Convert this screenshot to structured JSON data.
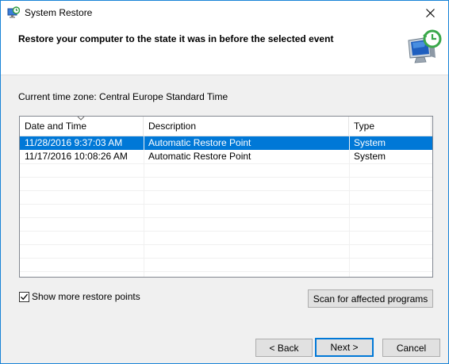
{
  "window": {
    "title": "System Restore",
    "accent_color": "#1883d7"
  },
  "header": {
    "title": "Restore your computer to the state it was in before the selected event"
  },
  "timezone": {
    "label": "Current time zone: Central Europe Standard Time"
  },
  "table": {
    "columns": [
      "Date and Time",
      "Description",
      "Type"
    ],
    "sorted_column": "Date and Time",
    "rows": [
      {
        "date": "11/28/2016 9:37:03 AM",
        "description": "Automatic Restore Point",
        "type": "System",
        "selected": true
      },
      {
        "date": "11/17/2016 10:08:26 AM",
        "description": "Automatic Restore Point",
        "type": "System",
        "selected": false
      }
    ],
    "selection_color": "#0078d7"
  },
  "options": {
    "show_more_label": "Show more restore points",
    "show_more_checked": true
  },
  "buttons": {
    "scan": "Scan for affected programs",
    "back": "< Back",
    "next": "Next >",
    "cancel": "Cancel"
  },
  "icons": {
    "app": "system-restore-icon",
    "close": "close-icon",
    "header_art": "restore-monitor-clock-icon",
    "sort": "sort-arrow-icon",
    "check": "checkmark-icon"
  }
}
